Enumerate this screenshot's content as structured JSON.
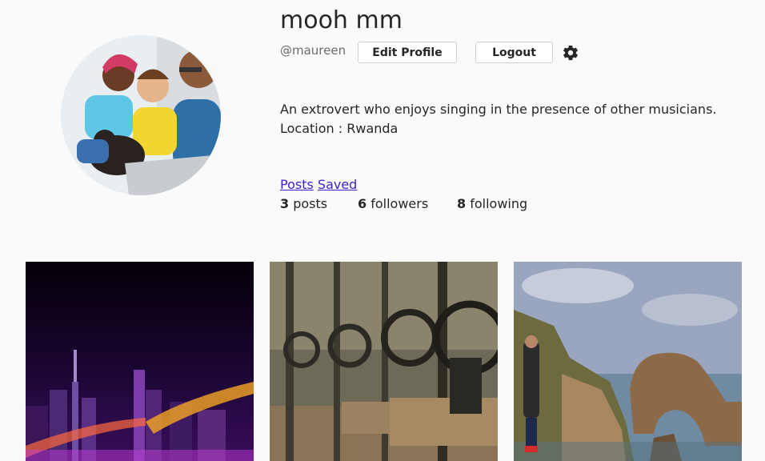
{
  "profile": {
    "display_name": "mooh mm",
    "handle": "@maureen",
    "bio_line1": "An extrovert who enjoys singing in the presence of other musicians.",
    "bio_line2": "Location : Rwanda"
  },
  "actions": {
    "edit_profile_label": "Edit Profile",
    "logout_label": "Logout",
    "settings_icon": "gear-icon"
  },
  "tabs": {
    "posts_label": "Posts",
    "saved_label": "Saved"
  },
  "stats": {
    "posts_count": "3",
    "posts_label": "posts",
    "followers_count": "6",
    "followers_label": "followers",
    "following_count": "8",
    "following_label": "following"
  },
  "colors": {
    "link": "#3b1fd1",
    "background": "#fafafa"
  }
}
